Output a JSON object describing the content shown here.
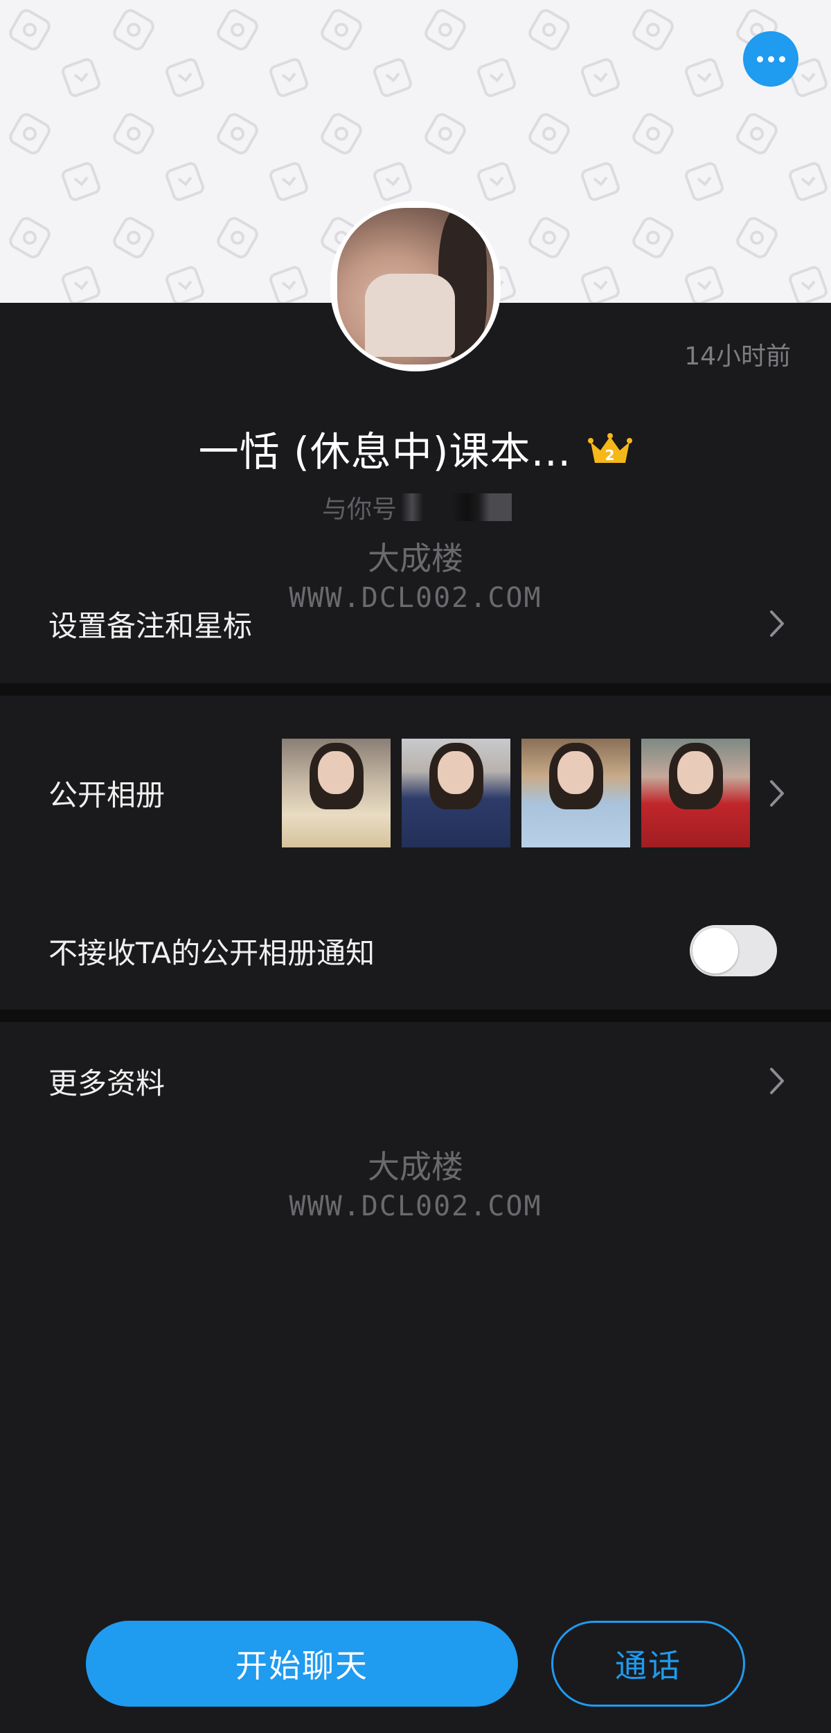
{
  "header": {
    "more_icon": "more-dots-icon"
  },
  "profile": {
    "time_ago": "14小时前",
    "name": "一恬 (休息中)课本…",
    "badge_level": "2",
    "relation_prefix": "与你号"
  },
  "watermarks": [
    {
      "cn": "大成楼",
      "en": "WWW.DCL002.COM"
    },
    {
      "cn": "大成楼",
      "en": "WWW.DCL002.COM"
    }
  ],
  "menu": {
    "remark_label": "设置备注和星标",
    "album_label": "公开相册",
    "album_notice_label": "不接收TA的公开相册通知",
    "album_notice_enabled": false,
    "more_info_label": "更多资料"
  },
  "actions": {
    "chat_label": "开始聊天",
    "call_label": "通话"
  },
  "colors": {
    "accent": "#1f9bf0",
    "background": "#1a1a1c",
    "badge": "#f6b819"
  }
}
